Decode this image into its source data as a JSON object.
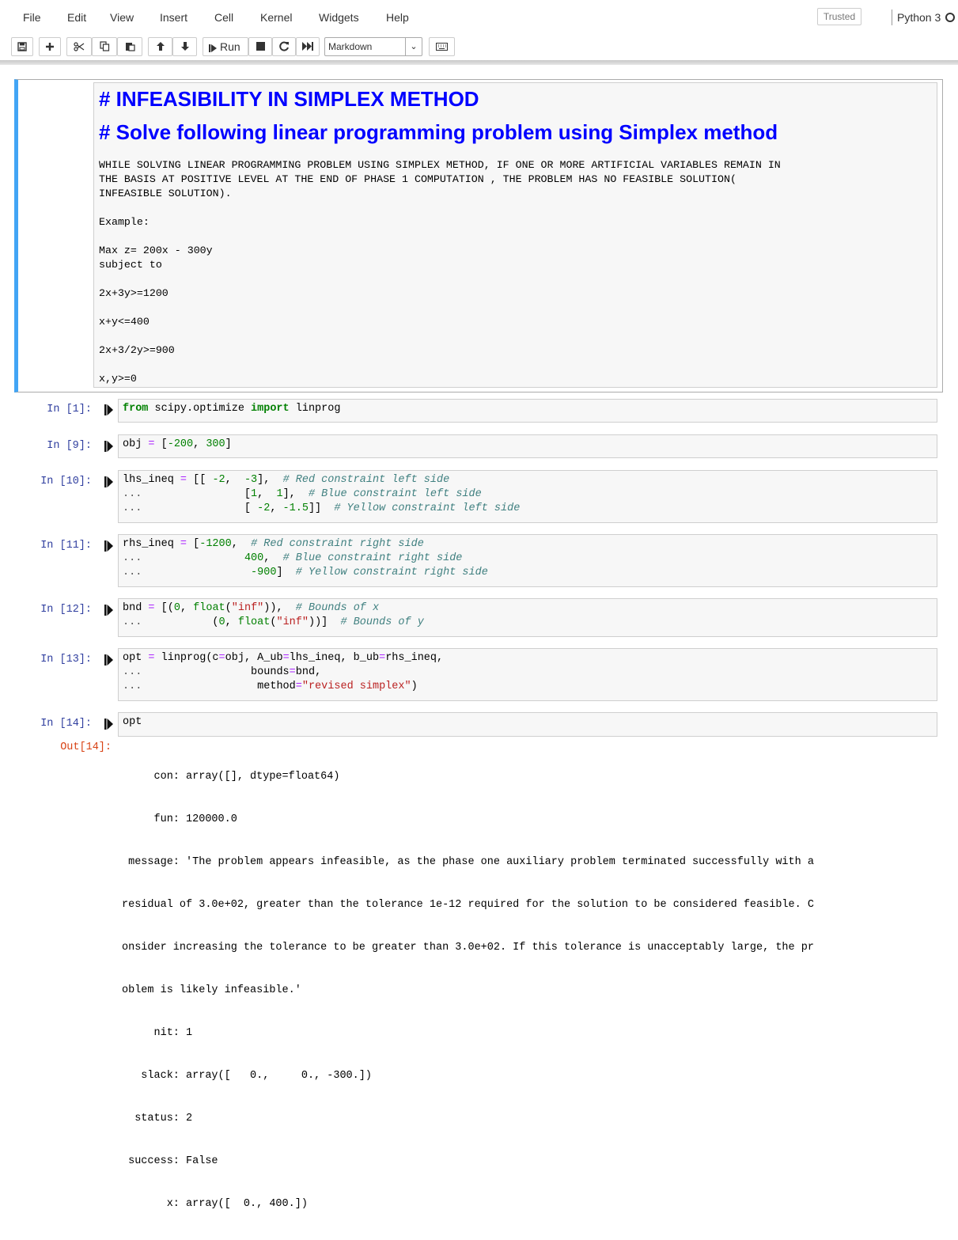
{
  "menubar": {
    "items": [
      "File",
      "Edit",
      "View",
      "Insert",
      "Cell",
      "Kernel",
      "Widgets",
      "Help"
    ],
    "trusted": "Trusted",
    "kernel": "Python 3"
  },
  "toolbar": {
    "run_label": "Run",
    "cell_type": "Markdown"
  },
  "markdown_cell": {
    "heading1": "# INFEASIBILITY IN SIMPLEX METHOD",
    "heading2": "# Solve following linear programming problem using Simplex method",
    "paragraph": [
      "WHILE SOLVING LINEAR PROGRAMMING PROBLEM USING SIMPLEX METHOD, IF ONE OR MORE ARTIFICIAL VARIABLES REMAIN IN",
      "THE BASIS AT POSITIVE LEVEL AT THE END OF PHASE 1 COMPUTATION , THE PROBLEM HAS NO FEASIBLE SOLUTION(",
      "INFEASIBLE SOLUTION)."
    ],
    "example": "Example:",
    "objective": [
      "Max z= 200x - 300y",
      "subject to"
    ],
    "constraints": [
      "2x+3y>=1200",
      "x+y<=400",
      "2x+3/2y>=900",
      "x,y>=0"
    ]
  },
  "cells": [
    {
      "prompt": "In [1]:"
    },
    {
      "prompt": "In [9]:"
    },
    {
      "prompt": "In [10]:"
    },
    {
      "prompt": "In [11]:"
    },
    {
      "prompt": "In [12]:"
    },
    {
      "prompt": "In [13]:"
    },
    {
      "prompt": "In [14]:"
    }
  ],
  "code": {
    "c1": {
      "kw1": "from",
      "mod": " scipy.optimize ",
      "kw2": "import",
      "name": " linprog"
    },
    "c2": {
      "a": "obj ",
      "eq": "=",
      "b": " [",
      "n1": "-200",
      "c": ", ",
      "n2": "300",
      "d": "]"
    },
    "c3": {
      "l1a": "lhs_ineq ",
      "eq": "=",
      "l1b": " [[ ",
      "l1n1": "-2",
      "l1c": ",  ",
      "l1n2": "-3",
      "l1d": "],  ",
      "l1cmt": "# Red constraint left side",
      "cont": "...",
      "l2a": "                [",
      "l2n1": "1",
      "l2c": ",  ",
      "l2n2": "1",
      "l2d": "],  ",
      "l2cmt": "# Blue constraint left side",
      "l3a": "                [ ",
      "l3n1": "-2",
      "l3c": ", ",
      "l3n2": "-1.5",
      "l3d": "]]  ",
      "l3cmt": "# Yellow constraint left side"
    },
    "c4": {
      "l1a": "rhs_ineq ",
      "eq": "=",
      "l1b": " [",
      "l1n": "-1200",
      "l1c": ",  ",
      "l1cmt": "# Red constraint right side",
      "cont": "...",
      "l2a": "                ",
      "l2n": "400",
      "l2c": ",  ",
      "l2cmt": "# Blue constraint right side",
      "l3a": "                 ",
      "l3n": "-900",
      "l3c": "]  ",
      "l3cmt": "# Yellow constraint right side"
    },
    "c5": {
      "l1a": "bnd ",
      "eq": "=",
      "l1b": " [(",
      "n0": "0",
      "l1c": ", ",
      "fn": "float",
      "l1d": "(",
      "str": "\"inf\"",
      "l1e": ")),  ",
      "l1cmt": "# Bounds of x",
      "cont": "...",
      "l2a": "           (",
      "l2c": ", ",
      "l2e": "))]  ",
      "l2cmt": "# Bounds of y"
    },
    "c6": {
      "l1a": "opt ",
      "eq": "=",
      "l1b": " linprog(c",
      "l1c": "obj, A_ub",
      "l1d": "lhs_ineq, b_ub",
      "l1e": "rhs_ineq,",
      "cont": "...",
      "l2a": "                 bounds",
      "l2b": "bnd,",
      "l3a": "                  method",
      "l3str": "\"revised simplex\"",
      "l3b": ")"
    },
    "c7": {
      "text": "opt"
    }
  },
  "output": {
    "prompt": "Out[14]:",
    "lines": [
      "     con: array([], dtype=float64)",
      "     fun: 120000.0",
      " message: 'The problem appears infeasible, as the phase one auxiliary problem terminated successfully with a",
      "residual of 3.0e+02, greater than the tolerance 1e-12 required for the solution to be considered feasible. C",
      "onsider increasing the tolerance to be greater than 3.0e+02. If this tolerance is unacceptably large, the pr",
      "oblem is likely infeasible.'",
      "     nit: 1",
      "   slack: array([   0.,     0., -300.])",
      "  status: 2",
      " success: False",
      "       x: array([  0., 400.])"
    ]
  }
}
